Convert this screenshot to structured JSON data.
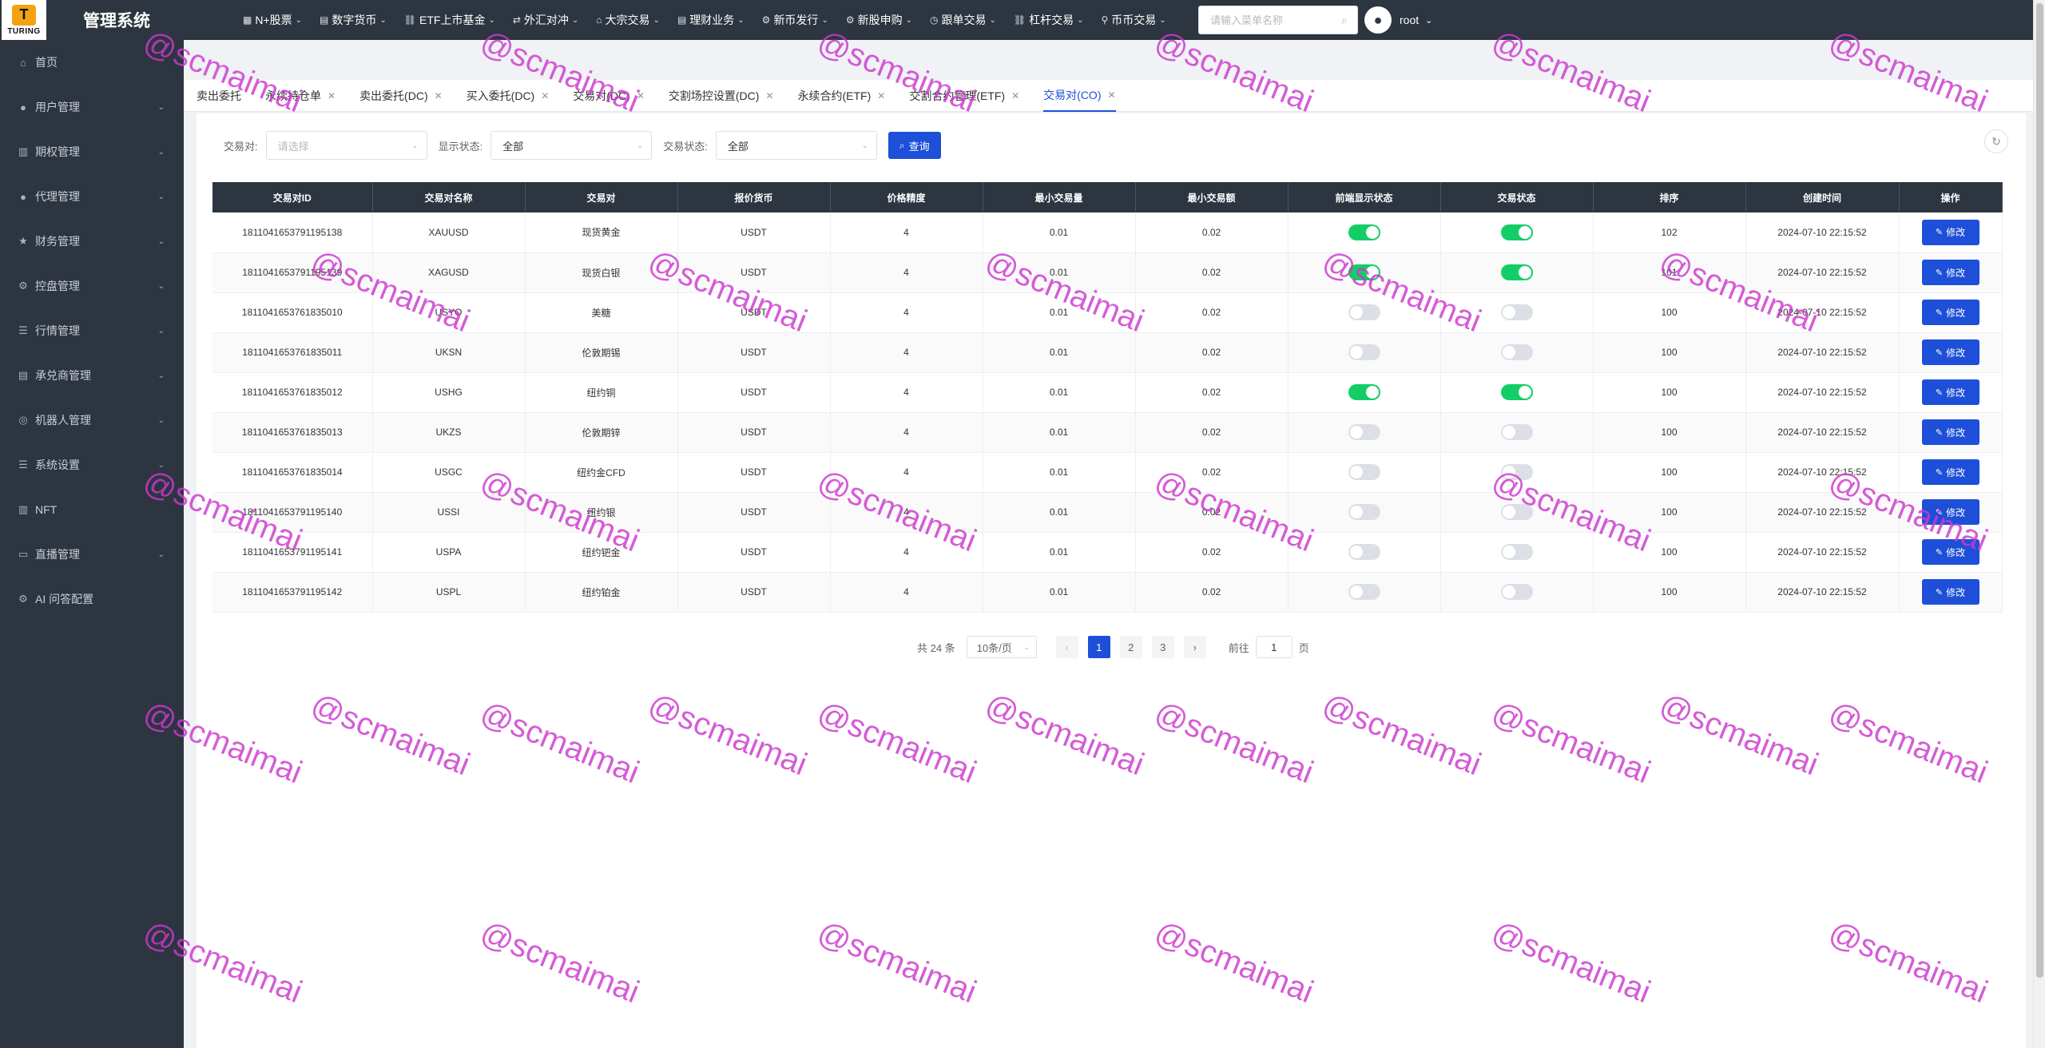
{
  "app": {
    "logo_text": "TURING",
    "logo_mark": "T",
    "title": "管理系统"
  },
  "topnav": [
    {
      "label": "N+股票",
      "icon": "grid-icon"
    },
    {
      "label": "数字货币",
      "icon": "wallet-icon"
    },
    {
      "label": "ETF上市基金",
      "icon": "link-icon"
    },
    {
      "label": "外汇对冲",
      "icon": "exchange-icon"
    },
    {
      "label": "大宗交易",
      "icon": "bank-icon"
    },
    {
      "label": "理财业务",
      "icon": "document-icon"
    },
    {
      "label": "新币发行",
      "icon": "gear-icon"
    },
    {
      "label": "新股申购",
      "icon": "gear-icon"
    },
    {
      "label": "跟单交易",
      "icon": "clock-icon"
    },
    {
      "label": "杠杆交易",
      "icon": "link-icon"
    },
    {
      "label": "币币交易",
      "icon": "location-icon"
    }
  ],
  "search": {
    "placeholder": "请输入菜单名称"
  },
  "user": {
    "name": "root"
  },
  "sidebar": [
    {
      "label": "首页",
      "icon": "home-icon",
      "expandable": false
    },
    {
      "label": "用户管理",
      "icon": "user-icon",
      "expandable": true
    },
    {
      "label": "期权管理",
      "icon": "chart-icon",
      "expandable": true
    },
    {
      "label": "代理管理",
      "icon": "user-icon",
      "expandable": true
    },
    {
      "label": "财务管理",
      "icon": "star-icon",
      "expandable": true
    },
    {
      "label": "控盘管理",
      "icon": "gear-icon",
      "expandable": true
    },
    {
      "label": "行情管理",
      "icon": "list-icon",
      "expandable": true
    },
    {
      "label": "承兑商管理",
      "icon": "document-icon",
      "expandable": true
    },
    {
      "label": "机器人管理",
      "icon": "robot-icon",
      "expandable": true
    },
    {
      "label": "系统设置",
      "icon": "list-icon",
      "expandable": true
    },
    {
      "label": "NFT",
      "icon": "bar-chart-icon",
      "expandable": false
    },
    {
      "label": "直播管理",
      "icon": "video-icon",
      "expandable": true
    },
    {
      "label": "AI 问答配置",
      "icon": "gear-icon",
      "expandable": false
    }
  ],
  "tabs": [
    {
      "label": "卖出委托",
      "active": false
    },
    {
      "label": "永续持仓单",
      "active": false
    },
    {
      "label": "卖出委托(DC)",
      "active": false
    },
    {
      "label": "买入委托(DC)",
      "active": false
    },
    {
      "label": "交易对(DC)",
      "active": false
    },
    {
      "label": "交割场控设置(DC)",
      "active": false
    },
    {
      "label": "永续合约(ETF)",
      "active": false
    },
    {
      "label": "交割合约管理(ETF)",
      "active": false
    },
    {
      "label": "交易对(CO)",
      "active": true
    }
  ],
  "filters": {
    "pair_label": "交易对:",
    "pair_placeholder": "请选择",
    "display_label": "显示状态:",
    "display_value": "全部",
    "trade_label": "交易状态:",
    "trade_value": "全部",
    "query_label": "查询"
  },
  "table": {
    "columns": [
      "交易对ID",
      "交易对名称",
      "交易对",
      "报价货币",
      "价格精度",
      "最小交易量",
      "最小交易额",
      "前端显示状态",
      "交易状态",
      "排序",
      "创建时间",
      "操作"
    ],
    "edit_label": "修改",
    "rows": [
      {
        "id": "1811041653791195138",
        "name": "XAUUSD",
        "pair": "现货黄金",
        "quote": "USDT",
        "precision": "4",
        "min_qty": "0.01",
        "min_amt": "0.02",
        "show": true,
        "trade": true,
        "sort": "102",
        "created": "2024-07-10 22:15:52"
      },
      {
        "id": "1811041653791195139",
        "name": "XAGUSD",
        "pair": "现货白银",
        "quote": "USDT",
        "precision": "4",
        "min_qty": "0.01",
        "min_amt": "0.02",
        "show": true,
        "trade": true,
        "sort": "101",
        "created": "2024-07-10 22:15:52"
      },
      {
        "id": "1811041653761835010",
        "name": "USYO",
        "pair": "美糖",
        "quote": "USDT",
        "precision": "4",
        "min_qty": "0.01",
        "min_amt": "0.02",
        "show": false,
        "trade": false,
        "sort": "100",
        "created": "2024-07-10 22:15:52"
      },
      {
        "id": "1811041653761835011",
        "name": "UKSN",
        "pair": "伦敦期锡",
        "quote": "USDT",
        "precision": "4",
        "min_qty": "0.01",
        "min_amt": "0.02",
        "show": false,
        "trade": false,
        "sort": "100",
        "created": "2024-07-10 22:15:52"
      },
      {
        "id": "1811041653761835012",
        "name": "USHG",
        "pair": "纽约铜",
        "quote": "USDT",
        "precision": "4",
        "min_qty": "0.01",
        "min_amt": "0.02",
        "show": true,
        "trade": true,
        "sort": "100",
        "created": "2024-07-10 22:15:52"
      },
      {
        "id": "1811041653761835013",
        "name": "UKZS",
        "pair": "伦敦期锌",
        "quote": "USDT",
        "precision": "4",
        "min_qty": "0.01",
        "min_amt": "0.02",
        "show": false,
        "trade": false,
        "sort": "100",
        "created": "2024-07-10 22:15:52"
      },
      {
        "id": "1811041653761835014",
        "name": "USGC",
        "pair": "纽约金CFD",
        "quote": "USDT",
        "precision": "4",
        "min_qty": "0.01",
        "min_amt": "0.02",
        "show": false,
        "trade": false,
        "sort": "100",
        "created": "2024-07-10 22:15:52"
      },
      {
        "id": "1811041653791195140",
        "name": "USSI",
        "pair": "纽约银",
        "quote": "USDT",
        "precision": "4",
        "min_qty": "0.01",
        "min_amt": "0.02",
        "show": false,
        "trade": false,
        "sort": "100",
        "created": "2024-07-10 22:15:52"
      },
      {
        "id": "1811041653791195141",
        "name": "USPA",
        "pair": "纽约钯金",
        "quote": "USDT",
        "precision": "4",
        "min_qty": "0.01",
        "min_amt": "0.02",
        "show": false,
        "trade": false,
        "sort": "100",
        "created": "2024-07-10 22:15:52"
      },
      {
        "id": "1811041653791195142",
        "name": "USPL",
        "pair": "纽约铂金",
        "quote": "USDT",
        "precision": "4",
        "min_qty": "0.01",
        "min_amt": "0.02",
        "show": false,
        "trade": false,
        "sort": "100",
        "created": "2024-07-10 22:15:52"
      }
    ]
  },
  "pagination": {
    "total_text": "共 24 条",
    "page_size": "10条/页",
    "pages": [
      "1",
      "2",
      "3"
    ],
    "current": "1",
    "goto_label": "前往",
    "goto_value": "1",
    "page_suffix": "页"
  },
  "watermark": "@scmaimai",
  "colors": {
    "sidebar_bg": "#2c3540",
    "accent": "#1d4fd8",
    "switch_on": "#13ce66",
    "watermark": "#cc38ce"
  }
}
